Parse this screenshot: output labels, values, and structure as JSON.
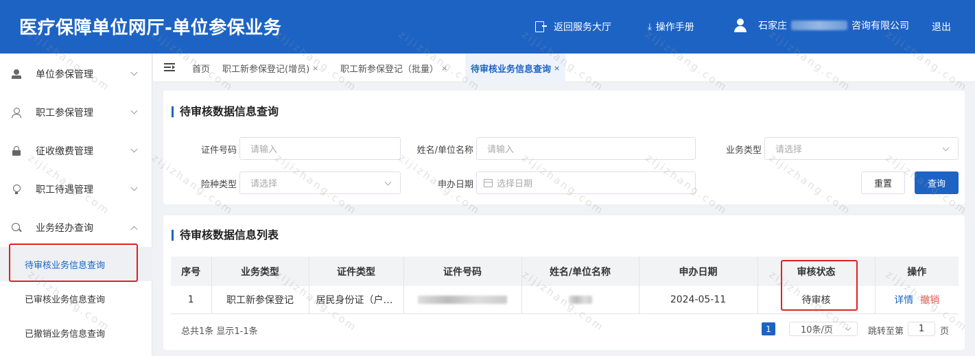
{
  "header": {
    "title": "医疗保障单位网厅-单位参保业务",
    "back_label": "返回服务大厅",
    "manual_label": "操作手册",
    "company_prefix": "石家庄",
    "company_suffix": "咨询有限公司",
    "logout_label": "退出"
  },
  "sidebar": {
    "items": [
      {
        "label": "单位参保管理"
      },
      {
        "label": "职工参保管理"
      },
      {
        "label": "征收缴费管理"
      },
      {
        "label": "职工待遇管理"
      },
      {
        "label": "业务经办查询"
      }
    ],
    "sub_items": [
      {
        "label": "待审核业务信息查询"
      },
      {
        "label": "已审核业务信息查询"
      },
      {
        "label": "已撤销业务信息查询"
      }
    ]
  },
  "tabs": [
    {
      "label": "首页"
    },
    {
      "label": "职工新参保登记(增员)",
      "close": "×"
    },
    {
      "label": "职工新参保登记（批量）",
      "close": "×"
    },
    {
      "label": "待审核业务信息查询",
      "close": "×"
    }
  ],
  "query": {
    "title": "待审核数据信息查询",
    "cert_no_label": "证件号码",
    "cert_no_placeholder": "请输入",
    "name_label": "姓名/单位名称",
    "name_placeholder": "请输入",
    "biz_type_label": "业务类型",
    "biz_type_placeholder": "请选择",
    "insurance_type_label": "险种类型",
    "insurance_type_placeholder": "请选择",
    "apply_date_label": "申办日期",
    "apply_date_placeholder": "选择日期",
    "reset_label": "重置",
    "search_label": "查询"
  },
  "list": {
    "title": "待审核数据信息列表",
    "columns": [
      "序号",
      "业务类型",
      "证件类型",
      "证件号码",
      "姓名/单位名称",
      "申办日期",
      "审核状态",
      "操作"
    ],
    "rows": [
      {
        "index": "1",
        "biz_type": "职工新参保登记",
        "cert_type": "居民身份证（户…",
        "apply_date": "2024-05-11",
        "status": "待审核",
        "detail_label": "详情",
        "revoke_label": "撤销"
      }
    ]
  },
  "pagination": {
    "summary": "总共1条 显示1-1条",
    "current_page": "1",
    "page_size": "10条/页",
    "jump_label": "跳转至第",
    "jump_value": "1",
    "page_unit": "页"
  },
  "watermark": "zijizhang.com",
  "colors": {
    "brand": "#1d63c4",
    "highlight_box": "#e02020",
    "revoke": "#e0584f"
  }
}
